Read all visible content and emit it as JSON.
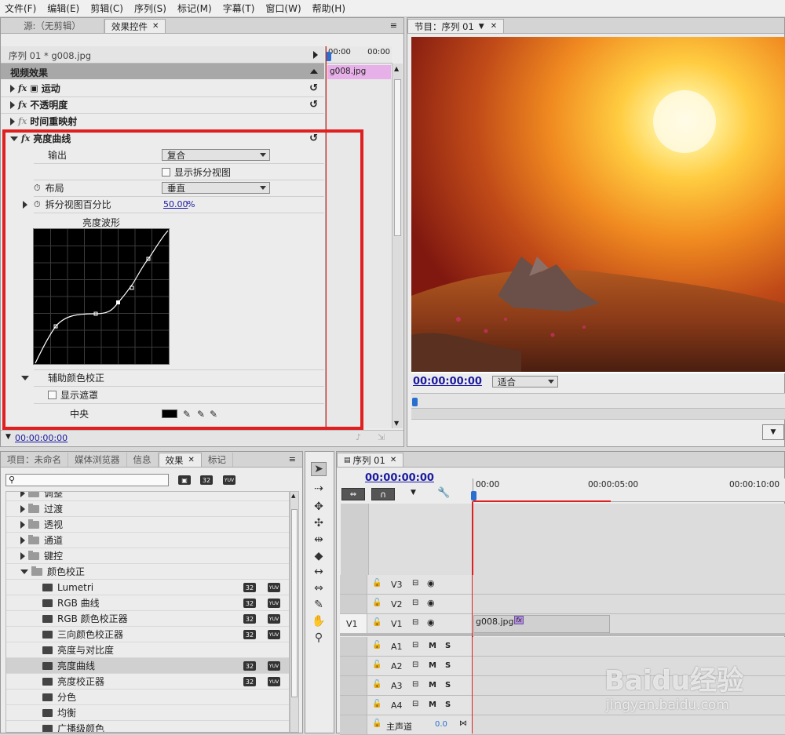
{
  "menu": [
    "文件(F)",
    "编辑(E)",
    "剪辑(C)",
    "序列(S)",
    "标记(M)",
    "字幕(T)",
    "窗口(W)",
    "帮助(H)"
  ],
  "effect_controls": {
    "tab_source": "源:（无剪辑）",
    "tab_effects": "效果控件",
    "sequence_label": "序列 01 * g008.jpg",
    "time_left": "00:00",
    "time_right": "00:00",
    "clip_name": "g008.jpg",
    "section_video_effects": "视频效果",
    "motion": "运动",
    "opacity": "不透明度",
    "time_remap": "时间重映射",
    "luma_curve": "亮度曲线",
    "output_label": "输出",
    "output_value": "复合",
    "show_split": "显示拆分视图",
    "layout_label": "布局",
    "layout_value": "垂直",
    "split_percent_label": "拆分视图百分比",
    "split_percent_value": "50.00",
    "split_percent_unit": "%",
    "waveform_label": "亮度波形",
    "secondary_cc": "辅助颜色校正",
    "show_mask": "显示遮罩",
    "center_label": "中央",
    "footer_time": "00:00:00:00"
  },
  "program": {
    "tab": "节目：序列 01",
    "timecode": "00:00:00:00",
    "fit": "适合"
  },
  "project": {
    "tabs": [
      "项目：未命名",
      "媒体浏览器",
      "信息",
      "效果",
      "标记"
    ],
    "badge_32": "32",
    "badge_yuv": "YUV",
    "folders": [
      "调整",
      "过渡",
      "透视",
      "通道",
      "键控",
      "颜色校正"
    ],
    "effects": [
      {
        "name": "Lumetri",
        "b32": true,
        "yuv": true
      },
      {
        "name": "RGB 曲线",
        "b32": true,
        "yuv": true
      },
      {
        "name": "RGB 颜色校正器",
        "b32": true,
        "yuv": true
      },
      {
        "name": "三向颜色校正器",
        "b32": true,
        "yuv": true
      },
      {
        "name": "亮度与对比度",
        "b32": false,
        "yuv": false
      },
      {
        "name": "亮度曲线",
        "b32": true,
        "yuv": true
      },
      {
        "name": "亮度校正器",
        "b32": true,
        "yuv": true
      },
      {
        "name": "分色",
        "b32": false,
        "yuv": false
      },
      {
        "name": "均衡",
        "b32": false,
        "yuv": false
      },
      {
        "name": "广播级颜色",
        "b32": false,
        "yuv": false
      }
    ]
  },
  "timeline": {
    "tab": "序列 01",
    "timecode": "00:00:00:00",
    "ruler": [
      "00:00",
      "00:00:05:00",
      "00:00:10:00"
    ],
    "video_tracks": [
      "V3",
      "V2",
      "V1"
    ],
    "source_patch": "V1",
    "clip_name": "g008.jpg",
    "audio_tracks": [
      "A1",
      "A2",
      "A3",
      "A4"
    ],
    "master": "主声道",
    "master_value": "0.0",
    "m_label": "M",
    "s_label": "S"
  },
  "watermark": {
    "brand": "Baidu经验",
    "url": "jingyan.baidu.com"
  },
  "colors": {
    "highlight": "#e02020",
    "accent_blue": "#1a1aa0",
    "clip_pink": "#e8b0e8"
  }
}
